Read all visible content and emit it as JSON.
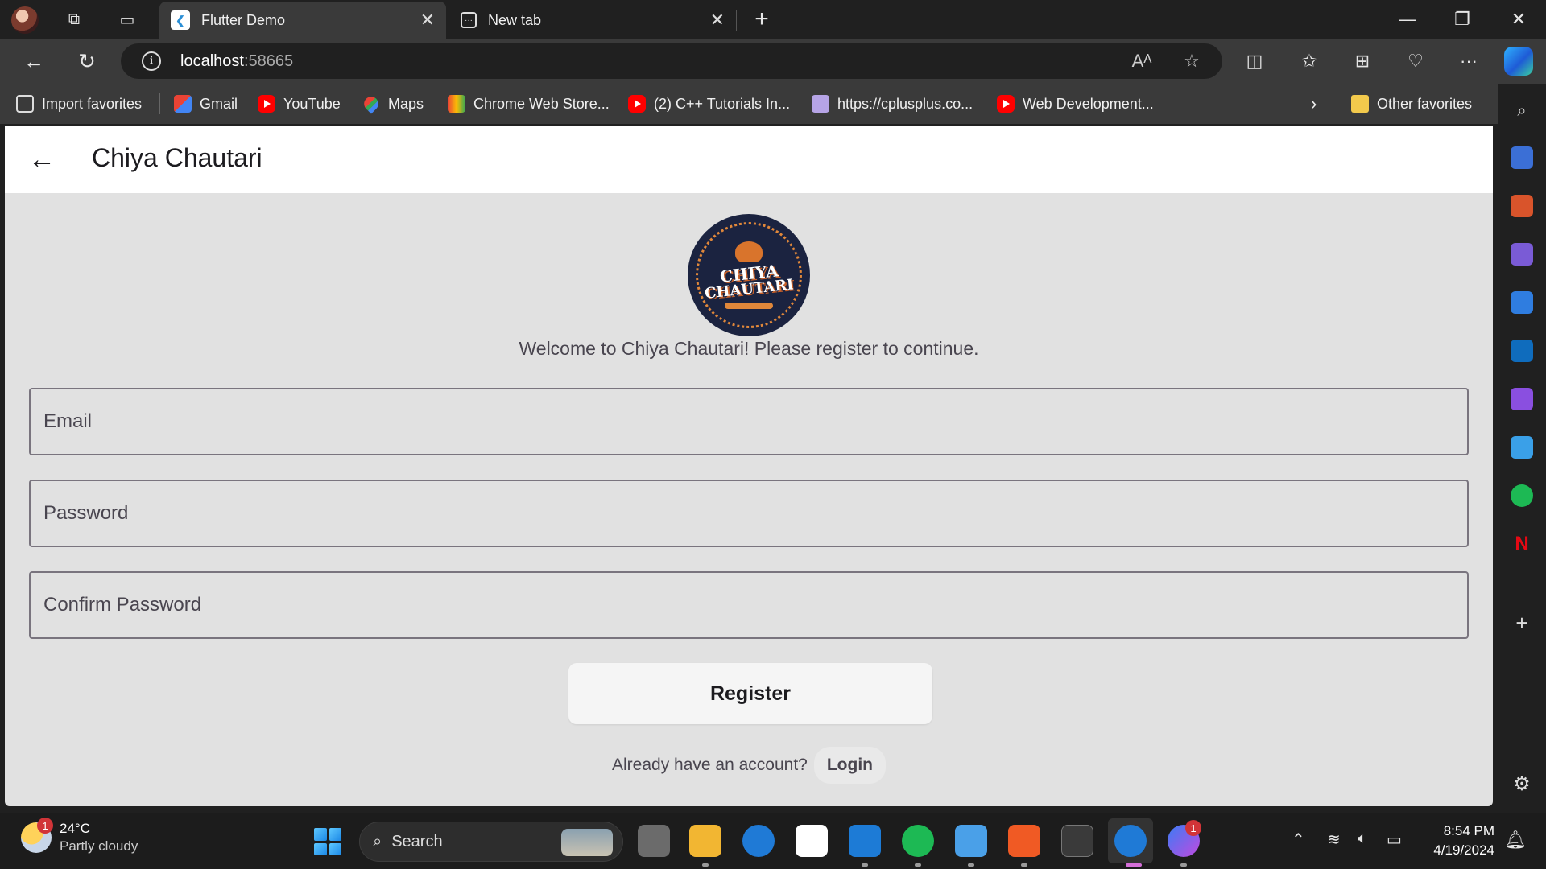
{
  "browser": {
    "tabs": [
      {
        "label": "Flutter Demo",
        "active": true
      },
      {
        "label": "New tab",
        "active": false
      }
    ],
    "address": {
      "host": "localhost",
      "port": ":58665"
    },
    "favorites": [
      {
        "label": "Import favorites",
        "icon": "import-icon"
      },
      {
        "label": "Gmail",
        "icon": "gmail-icon"
      },
      {
        "label": "YouTube",
        "icon": "youtube-icon"
      },
      {
        "label": "Maps",
        "icon": "maps-icon"
      },
      {
        "label": "Chrome Web Store...",
        "icon": "web-store-icon"
      },
      {
        "label": "(2) C++ Tutorials In...",
        "icon": "youtube-icon"
      },
      {
        "label": "https://cplusplus.co...",
        "icon": "cplusplus-icon"
      },
      {
        "label": "Web Development...",
        "icon": "youtube-icon"
      }
    ],
    "other_favorites": "Other favorites"
  },
  "app": {
    "title": "Chiya Chautari",
    "logo_text_line1": "CHIYA",
    "logo_text_line2": "CHAUTARI",
    "welcome": "Welcome to Chiya Chautari! Please register to continue.",
    "fields": {
      "email_placeholder": "Email",
      "password_placeholder": "Password",
      "confirm_placeholder": "Confirm Password"
    },
    "register_label": "Register",
    "already_text": "Already have an account?",
    "login_label": "Login"
  },
  "taskbar": {
    "weather_temp": "24°C",
    "weather_cond": "Partly cloudy",
    "weather_badge": "1",
    "search_label": "Search",
    "messenger_badge": "1",
    "time": "8:54 PM",
    "date": "4/19/2024"
  },
  "colors": {
    "page_bg": "#e1e1e1",
    "appbar_bg": "#ffffff",
    "button_bg": "#f5f5f5",
    "logo_bg": "#1b2340",
    "accent_orange": "#e0873a"
  }
}
